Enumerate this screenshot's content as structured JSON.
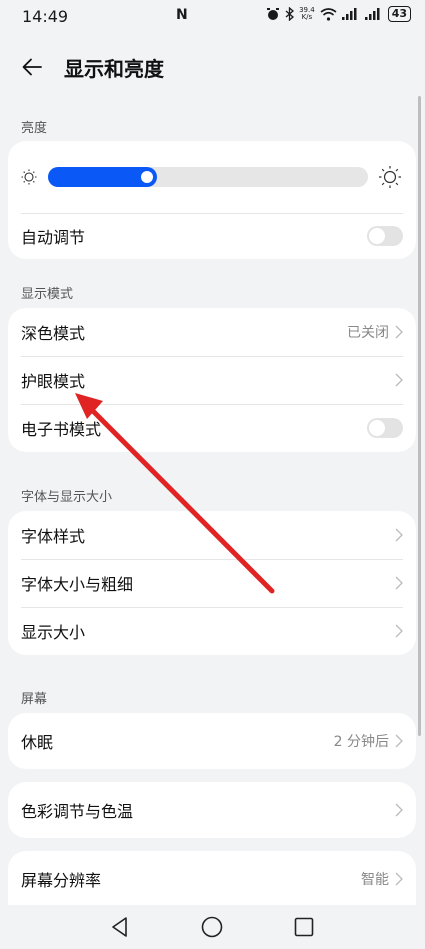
{
  "status_bar": {
    "time": "14:49",
    "nfc": "N",
    "speed_value": "39.4",
    "speed_unit": "K/s",
    "battery": "43"
  },
  "header": {
    "title": "显示和亮度"
  },
  "sections": {
    "brightness": {
      "label": "亮度",
      "level_percent": 34,
      "auto_label": "自动调节",
      "auto_on": false
    },
    "display_mode": {
      "label": "显示模式",
      "items": [
        {
          "label": "深色模式",
          "value": "已关闭",
          "control": "chevron"
        },
        {
          "label": "护眼模式",
          "value": "",
          "control": "chevron"
        },
        {
          "label": "电子书模式",
          "value": "",
          "control": "toggle"
        }
      ]
    },
    "font_size": {
      "label": "字体与显示大小",
      "items": [
        {
          "label": "字体样式"
        },
        {
          "label": "字体大小与粗细"
        },
        {
          "label": "显示大小"
        }
      ]
    },
    "screen": {
      "label": "屏幕",
      "sleep_label": "休眠",
      "sleep_value": "2 分钟后",
      "color_label": "色彩调节与色温",
      "resolution_label": "屏幕分辨率",
      "resolution_value": "智能"
    }
  },
  "colors": {
    "accent": "#0a59f7",
    "annotation_arrow": "#e02424",
    "background": "#f1f3f5"
  }
}
